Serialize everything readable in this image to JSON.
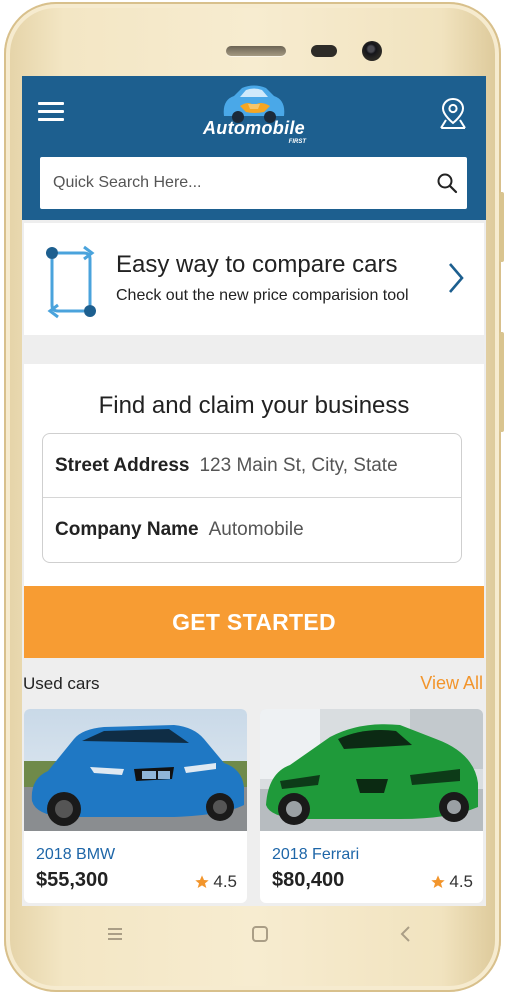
{
  "header": {
    "logo_text": "Automobile",
    "logo_sub": "FIRST",
    "search_placeholder": "Quick Search Here..."
  },
  "compare": {
    "title": "Easy way to compare cars",
    "subtitle": "Check out the new price comparision tool"
  },
  "business": {
    "title": "Find and claim your business",
    "fields": [
      {
        "label": "Street Address",
        "value": "123 Main St, City, State"
      },
      {
        "label": "Company Name",
        "value": "Automobile"
      }
    ],
    "cta": "GET STARTED"
  },
  "used_cars": {
    "title": "Used cars",
    "view_all": "View All",
    "items": [
      {
        "name": "2018 BMW",
        "price": "$55,300",
        "rating": "4.5",
        "color": "#1f78c4"
      },
      {
        "name": "2018 Ferrari",
        "price": "$80,400",
        "rating": "4.5",
        "color": "#1f9a3a"
      }
    ]
  },
  "colors": {
    "header": "#1d5f8f",
    "accent": "#f79c33",
    "link": "#1e66a8"
  }
}
